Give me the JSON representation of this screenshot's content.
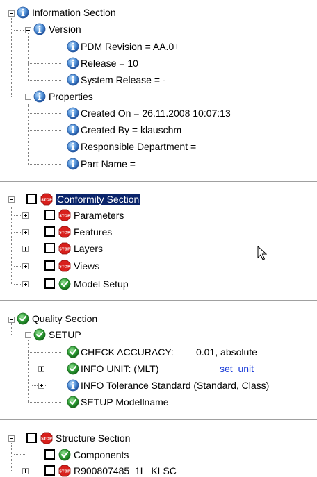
{
  "colors": {
    "info": "#3a77c8",
    "stop": "#e0201c",
    "ok": "#2a9b2a",
    "selection": "#0a246a",
    "link": "#1a3cd8"
  },
  "info_section": {
    "label": "Information Section",
    "version": {
      "label": "Version",
      "items": [
        "PDM Revision = AA.0+",
        "Release = 10",
        "System Release = -"
      ]
    },
    "properties": {
      "label": "Properties",
      "items": [
        "Created On = 26.11.2008 10:07:13",
        "Created By = klauschm",
        "Responsible Department =",
        "Part Name ="
      ]
    }
  },
  "conformity_section": {
    "label": "Conformity Section",
    "items": [
      {
        "label": "Parameters",
        "status": "stop-icon"
      },
      {
        "label": "Features",
        "status": "stop-icon"
      },
      {
        "label": "Layers",
        "status": "stop-icon"
      },
      {
        "label": "Views",
        "status": "stop-icon"
      },
      {
        "label": "Model Setup",
        "status": "check-icon"
      }
    ]
  },
  "quality_section": {
    "label": "Quality Section",
    "setup": {
      "label": "SETUP",
      "check_accuracy": {
        "label": "CHECK ACCURACY:",
        "value": "0.01, absolute"
      },
      "info_unit": {
        "label": "INFO UNIT:  (MLT)",
        "link": "set_unit"
      },
      "info_tolerance": "INFO Tolerance Standard  (Standard, Class)",
      "modellname": "SETUP Modellname"
    }
  },
  "structure_section": {
    "label": "Structure Section",
    "items": [
      {
        "label": "Components",
        "status": "check-icon"
      },
      {
        "label": "R900807485_1L_KLSC",
        "status": "stop-icon"
      }
    ]
  }
}
